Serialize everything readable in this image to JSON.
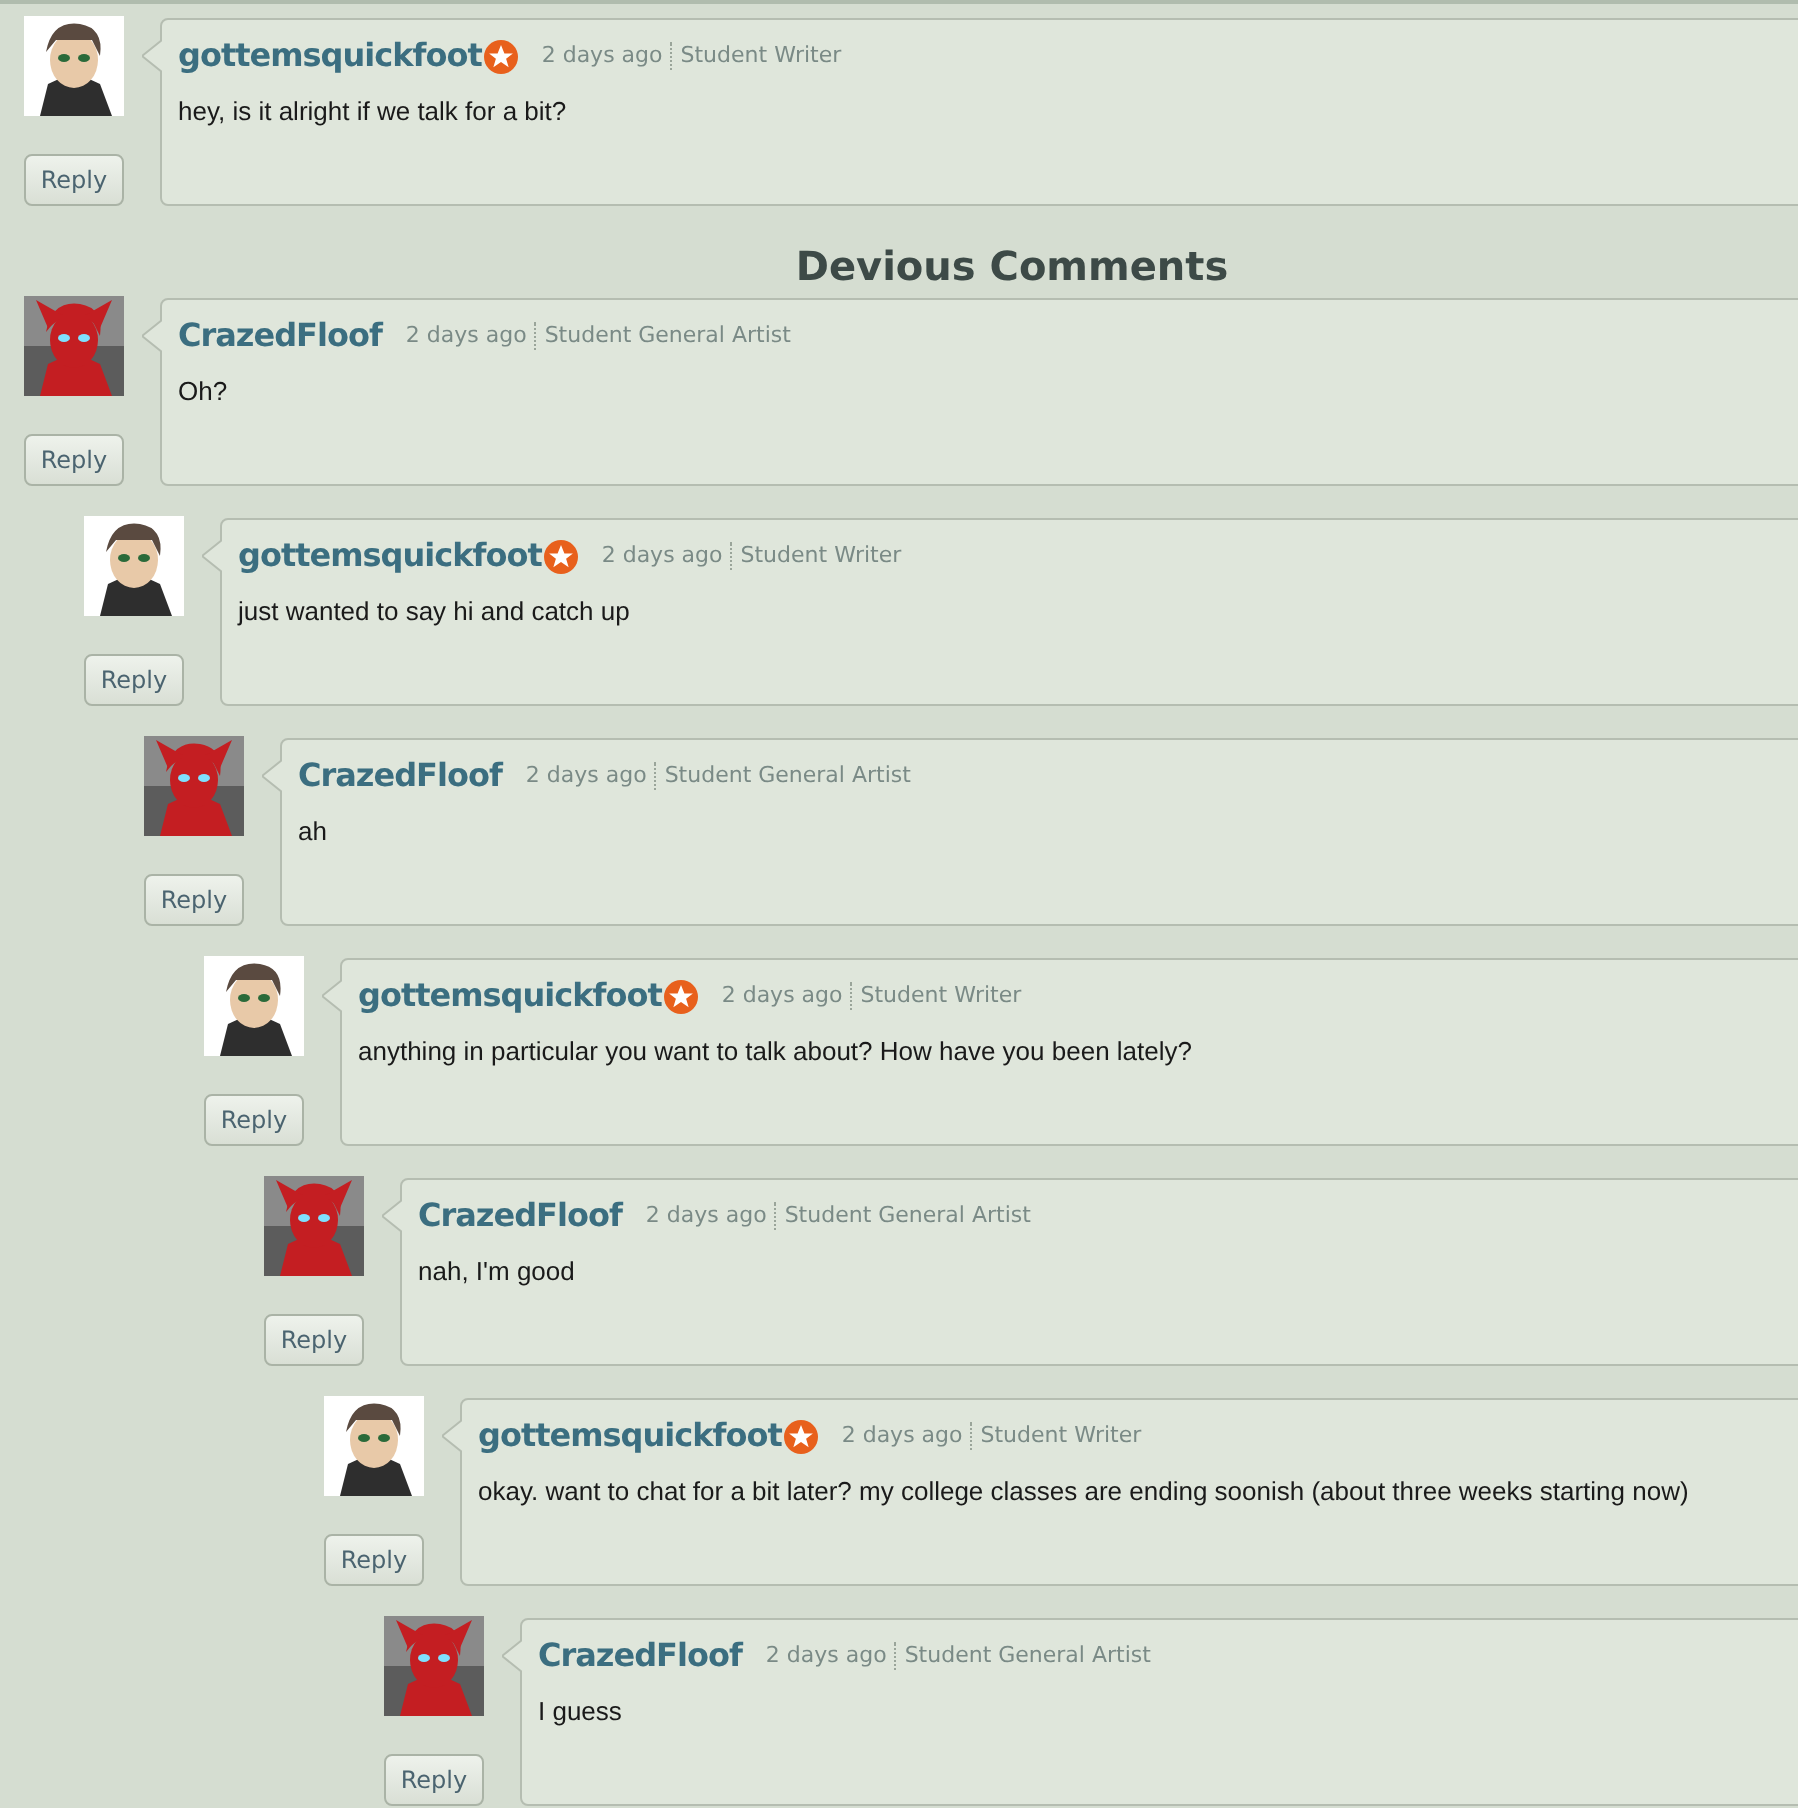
{
  "comments": [
    {
      "author": "gottemsquickfoot",
      "badge": true,
      "time": "2 days ago",
      "role": "Student Writer",
      "text": "hey, is it alright if we talk for a bit?",
      "reply": "Reply"
    }
  ],
  "section_title": "Devious Comments",
  "thread": [
    {
      "author": "CrazedFloof",
      "badge": false,
      "time": "2 days ago",
      "role": "Student General Artist",
      "text": "Oh?",
      "reply": "Reply",
      "children": [
        {
          "author": "gottemsquickfoot",
          "badge": true,
          "time": "2 days ago",
          "role": "Student Writer",
          "text": "just wanted to say hi and catch up",
          "reply": "Reply",
          "children": [
            {
              "author": "CrazedFloof",
              "badge": false,
              "time": "2 days ago",
              "role": "Student General Artist",
              "text": "ah",
              "reply": "Reply",
              "children": [
                {
                  "author": "gottemsquickfoot",
                  "badge": true,
                  "time": "2 days ago",
                  "role": "Student Writer",
                  "text": "anything in particular you want to talk about? How have you been lately?",
                  "reply": "Reply",
                  "children": [
                    {
                      "author": "CrazedFloof",
                      "badge": false,
                      "time": "2 days ago",
                      "role": "Student General Artist",
                      "text": "nah, I'm good",
                      "reply": "Reply",
                      "children": [
                        {
                          "author": "gottemsquickfoot",
                          "badge": true,
                          "time": "2 days ago",
                          "role": "Student Writer",
                          "text": "okay. want to chat for a bit later? my college classes are ending soonish (about three weeks starting now)",
                          "reply": "Reply",
                          "children": [
                            {
                              "author": "CrazedFloof",
                              "badge": false,
                              "time": "2 days ago",
                              "role": "Student General Artist",
                              "text": "I guess",
                              "reply": "Reply"
                            }
                          ]
                        }
                      ]
                    }
                  ]
                }
              ]
            }
          ]
        }
      ]
    }
  ]
}
